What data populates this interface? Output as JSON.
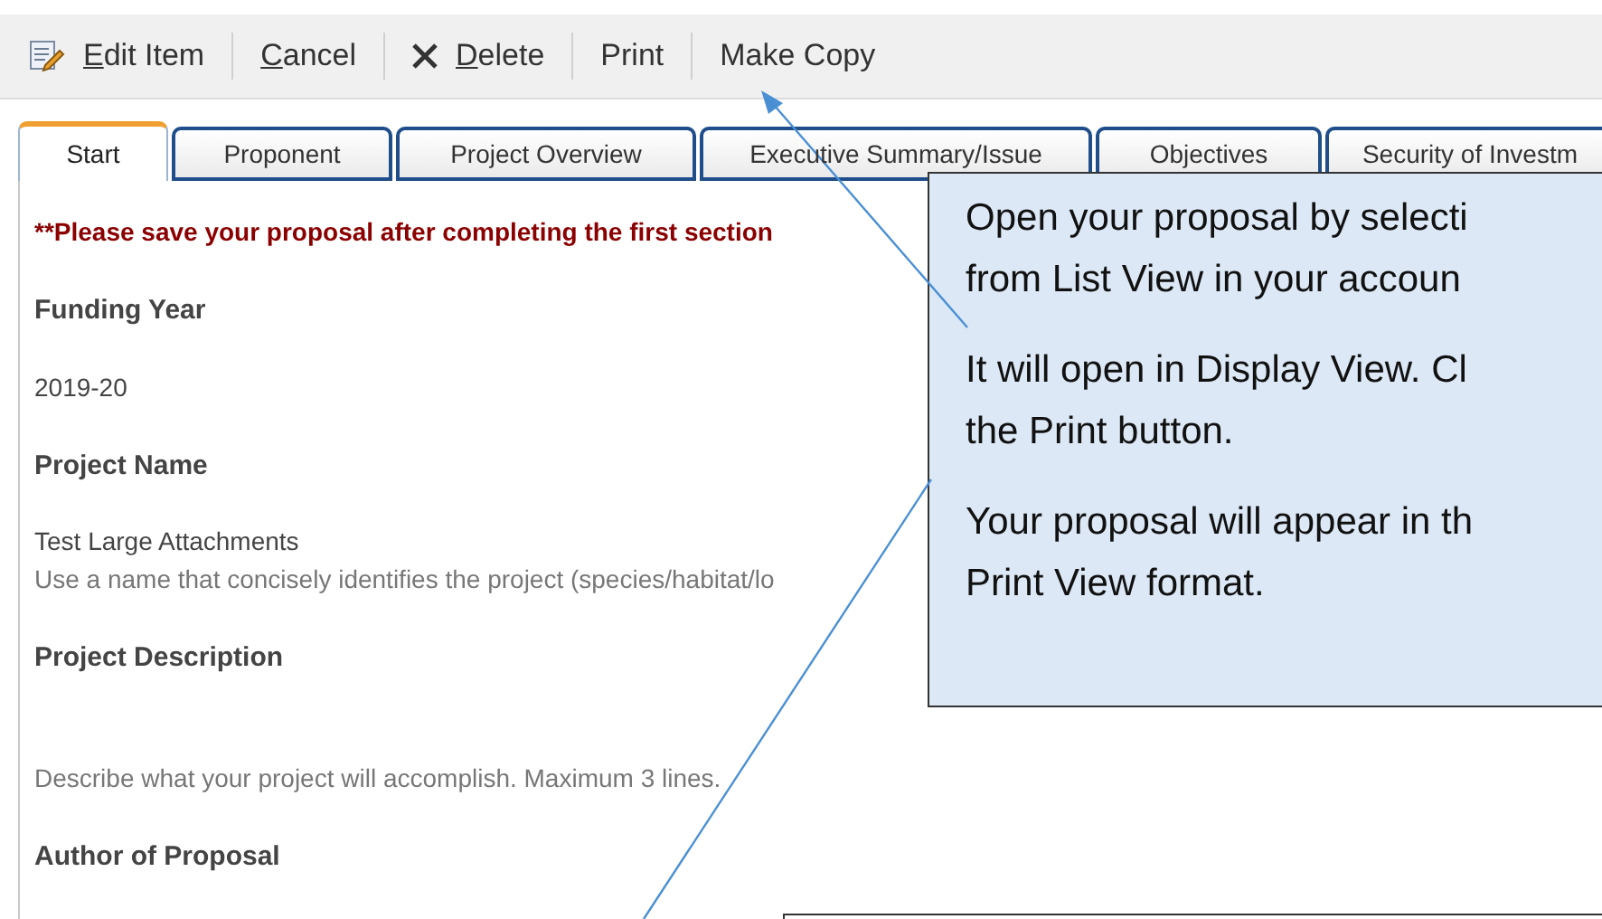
{
  "toolbar": [
    {
      "kind": "edit",
      "label": "Edit Item",
      "underlined": true
    },
    {
      "kind": "plain",
      "label": "Cancel",
      "underlined": true
    },
    {
      "kind": "delete",
      "label": "Delete",
      "underlined": true
    },
    {
      "kind": "plain",
      "label": "Print",
      "underlined": false
    },
    {
      "kind": "plain",
      "label": "Make Copy",
      "underlined": false
    }
  ],
  "tabs": [
    {
      "label": "Start",
      "selected": true
    },
    {
      "label": "Proponent",
      "selected": false
    },
    {
      "label": "Project Overview",
      "selected": false
    },
    {
      "label": "Executive Summary/Issue",
      "selected": false
    },
    {
      "label": "Objectives",
      "selected": false
    },
    {
      "label": "Security of Investm",
      "selected": false
    }
  ],
  "notice": "**Please save your proposal after completing the first section",
  "fields": [
    {
      "label": "Funding Year",
      "value": "2019-20"
    },
    {
      "label": "Project Name",
      "value": "Test Large Attachments",
      "hint": "Use a name that concisely identifies the project (species/habitat/lo"
    },
    {
      "label": "Project Description",
      "hint": "Describe what your project will accomplish. Maximum 3 lines."
    },
    {
      "label": "Author of Proposal"
    }
  ],
  "callout": {
    "paragraphs": [
      [
        "Open your proposal by selecti",
        "from List View in your accoun"
      ],
      [
        "It will open in Display View. Cl",
        "the Print button."
      ],
      [
        "Your proposal will appear in th",
        "Print View format."
      ]
    ]
  }
}
